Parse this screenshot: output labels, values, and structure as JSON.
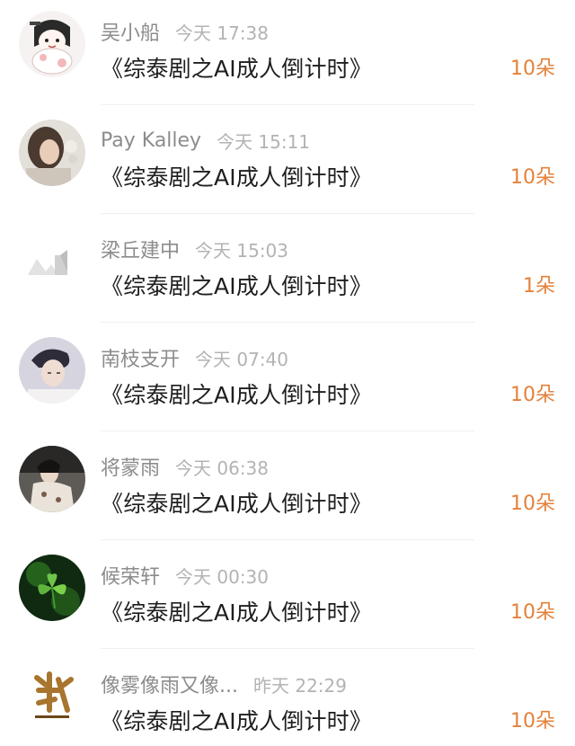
{
  "items": [
    {
      "username": "吴小船",
      "time": "今天 17:38",
      "title": "《综泰剧之AI成人倒计时》",
      "count": "10朵",
      "avatar": {
        "icon": "cartoon-girl-avatar",
        "colors": [
          "#f4e6e6",
          "#2a2a2a",
          "#ffffff"
        ]
      }
    },
    {
      "username": "Pay Kalley",
      "time": "今天 15:11",
      "title": "《综泰剧之AI成人倒计时》",
      "count": "10朵",
      "avatar": {
        "icon": "photo-portrait-avatar",
        "colors": [
          "#d8d4ce",
          "#6b5a4e",
          "#e9e4de"
        ]
      }
    },
    {
      "username": "梁丘建中",
      "time": "今天 15:03",
      "title": "《综泰剧之AI成人倒计时》",
      "count": "1朵",
      "avatar": {
        "icon": "faded-sketch-avatar",
        "colors": [
          "#ffffff",
          "#e6e6e6",
          "#bcbcbc"
        ]
      }
    },
    {
      "username": "南枝支开",
      "time": "今天 07:40",
      "title": "《综泰剧之AI成人倒计时》",
      "count": "10朵",
      "avatar": {
        "icon": "photo-portrait-avatar",
        "colors": [
          "#c9c8d6",
          "#3b3a48",
          "#f1eef0"
        ]
      }
    },
    {
      "username": "将蒙雨",
      "time": "今天 06:38",
      "title": "《综泰剧之AI成人倒计时》",
      "count": "10朵",
      "avatar": {
        "icon": "photo-portrait-avatar",
        "colors": [
          "#6f6a62",
          "#1d1b1a",
          "#e8e2da"
        ]
      }
    },
    {
      "username": "候荣轩",
      "time": "今天 00:30",
      "title": "《综泰剧之AI成人倒计时》",
      "count": "10朵",
      "avatar": {
        "icon": "clover-leaf-avatar",
        "colors": [
          "#0f2a10",
          "#3f9a2c",
          "#7bd04a"
        ]
      }
    },
    {
      "username": "像雾像雨又像...",
      "time": "昨天 22:29",
      "title": "《综泰剧之AI成人倒计时》",
      "count": "10朵",
      "avatar": {
        "icon": "calligraphy-logo-avatar",
        "colors": [
          "#ffffff",
          "#a8752e",
          "#6b4617"
        ]
      }
    }
  ],
  "accent_color": "#e4813a"
}
